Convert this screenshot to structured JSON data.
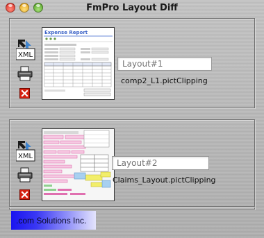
{
  "window": {
    "title": "FmPro Layout Diff",
    "buttons": [
      "close",
      "minimize",
      "zoom"
    ]
  },
  "layouts": [
    {
      "name_placeholder": "Layout#1",
      "name_value": "",
      "filename": "comp2_L1.pictClipping",
      "icons": [
        "xml-export-icon",
        "printer-icon",
        "remove-icon"
      ],
      "thumbnail": {
        "title": "Expense Report"
      }
    },
    {
      "name_placeholder": "Layout#2",
      "name_value": "",
      "filename": "Claims_Layout.pictClipping",
      "icons": [
        "xml-export-icon",
        "printer-icon",
        "remove-icon"
      ],
      "thumbnail": {}
    }
  ],
  "footer": {
    "company": ".com Solutions Inc."
  },
  "colors": {
    "remove": "#d42010",
    "logo_gradient_start": "#1a14f0",
    "logo_gradient_end": "#e4e4fc",
    "thumb_header": "#3d64c8"
  }
}
